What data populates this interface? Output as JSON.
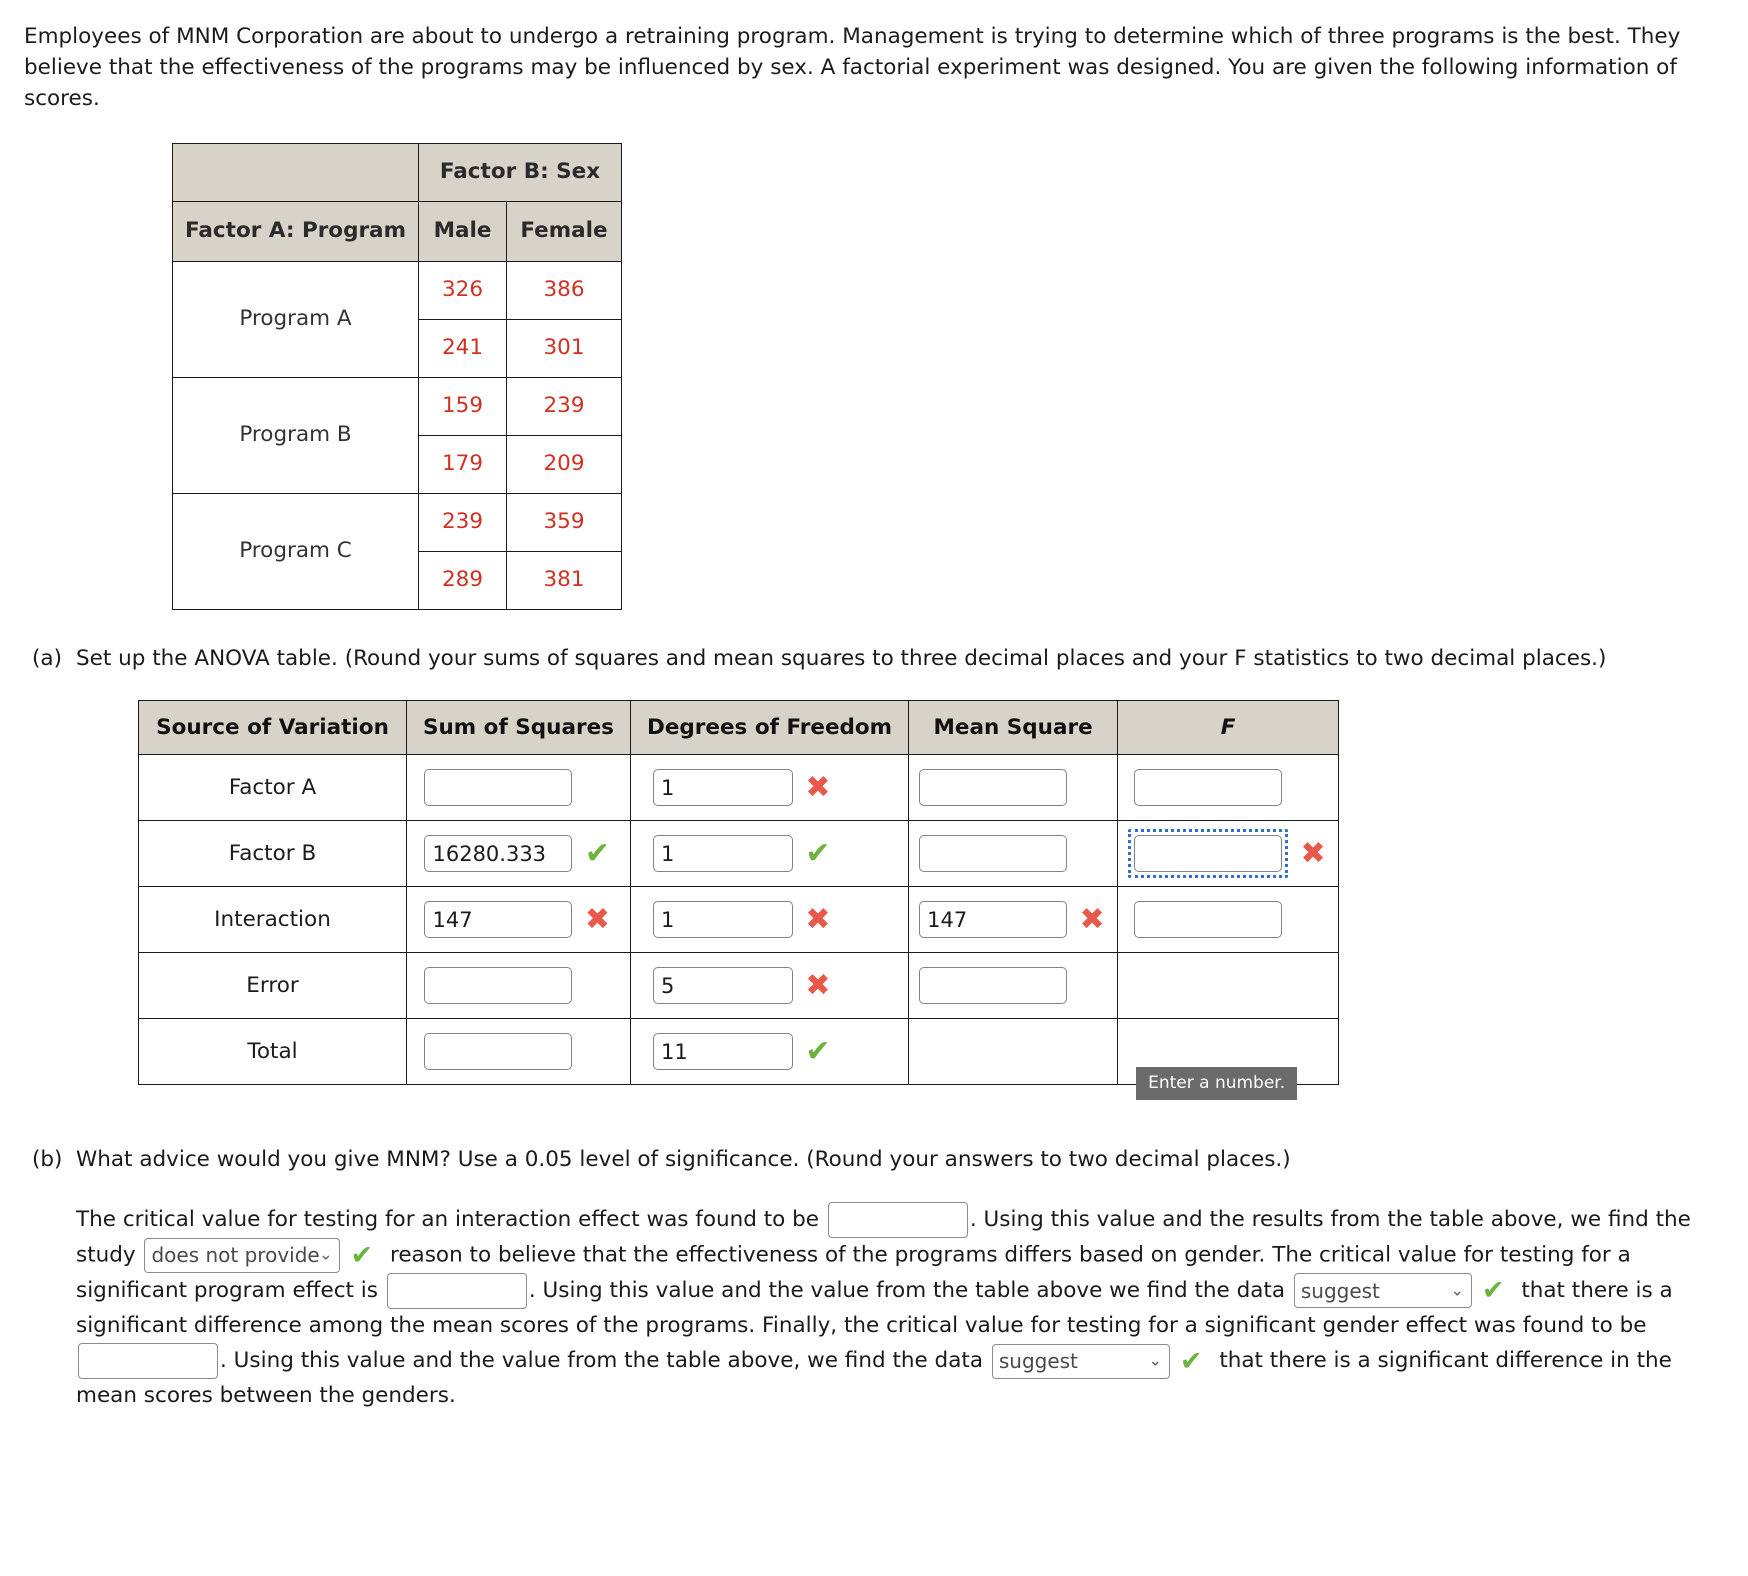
{
  "intro": "Employees of MNM Corporation are about to undergo a retraining program. Management is trying to determine which of three programs is the best. They believe that the effectiveness of the programs may be influenced by sex. A factorial experiment was designed. You are given the following information of scores.",
  "data_table": {
    "factor_b_header": "Factor B: Sex",
    "factor_a_header": "Factor A: Program",
    "col_male": "Male",
    "col_female": "Female",
    "rows": [
      {
        "program": "Program A",
        "male": [
          "326",
          "241"
        ],
        "female": [
          "386",
          "301"
        ]
      },
      {
        "program": "Program B",
        "male": [
          "159",
          "179"
        ],
        "female": [
          "239",
          "209"
        ]
      },
      {
        "program": "Program C",
        "male": [
          "239",
          "289"
        ],
        "female": [
          "359",
          "381"
        ]
      }
    ]
  },
  "part_a": {
    "letter": "(a)",
    "prompt": "Set up the ANOVA table. (Round your sums of squares and mean squares to three decimal places and your F statistics to two decimal places.)",
    "headers": {
      "source": "Source of Variation",
      "ss": "Sum of Squares",
      "df": "Degrees of Freedom",
      "ms": "Mean Square",
      "f": "F"
    },
    "rows": [
      {
        "source": "Factor A",
        "ss": {
          "value": "",
          "mark": "none"
        },
        "df": {
          "value": "1",
          "mark": "x"
        },
        "ms": {
          "value": "",
          "mark": "none"
        },
        "f": {
          "value": "",
          "mark": "none",
          "focused": false
        }
      },
      {
        "source": "Factor B",
        "ss": {
          "value": "16280.333",
          "mark": "ok"
        },
        "df": {
          "value": "1",
          "mark": "ok"
        },
        "ms": {
          "value": "",
          "mark": "none"
        },
        "f": {
          "value": "",
          "mark": "x",
          "focused": true
        }
      },
      {
        "source": "Interaction",
        "ss": {
          "value": "147",
          "mark": "x"
        },
        "df": {
          "value": "1",
          "mark": "x"
        },
        "ms": {
          "value": "147",
          "mark": "x"
        },
        "f": {
          "value": "",
          "mark": "none",
          "focused": false
        }
      },
      {
        "source": "Error",
        "ss": {
          "value": "",
          "mark": "none"
        },
        "df": {
          "value": "5",
          "mark": "x"
        },
        "ms": {
          "value": "",
          "mark": "none"
        },
        "f": {
          "value": null,
          "mark": "none",
          "focused": false
        }
      },
      {
        "source": "Total",
        "ss": {
          "value": "",
          "mark": "none"
        },
        "df": {
          "value": "11",
          "mark": "ok"
        },
        "ms": {
          "value": null,
          "mark": "none"
        },
        "f": {
          "value": null,
          "mark": "none",
          "focused": false
        }
      }
    ],
    "tooltip": "Enter a number."
  },
  "part_b": {
    "letter": "(b)",
    "prompt": "What advice would you give MNM? Use a 0.05 level of significance. (Round your answers to two decimal places.)",
    "t1": "The critical value for testing for an interaction effect was found to be",
    "t2": ". Using this value and the results from the table above, we find the study",
    "t3": "reason to believe that the effectiveness of the programs differs based on gender. The critical value for testing for a significant program effect is",
    "t4": ". Using this value and the value from the table above we find the data",
    "t5": "that there is a significant difference among the mean scores of the programs. Finally, the critical value for testing for a significant gender effect was found to be",
    "t6": ". Using this value and the value from the table above, we find the data",
    "t7": "that there is a significant difference in the mean scores between the genders.",
    "interaction_critical_value": "",
    "program_critical_value": "",
    "gender_critical_value": "",
    "dd1_value": "does not provide",
    "dd2_value": "suggest",
    "dd3_value": "suggest",
    "chevron": "⌄"
  },
  "colors": {
    "header_bg": "#d7d3c9",
    "data_red": "#cf3222",
    "check_green": "#6cb33f",
    "cross_red": "#e8594c",
    "focus_blue": "#2f6fcf",
    "tooltip_bg": "#6b6b6b"
  },
  "glyphs": {
    "check": "✔",
    "cross": "✖"
  }
}
